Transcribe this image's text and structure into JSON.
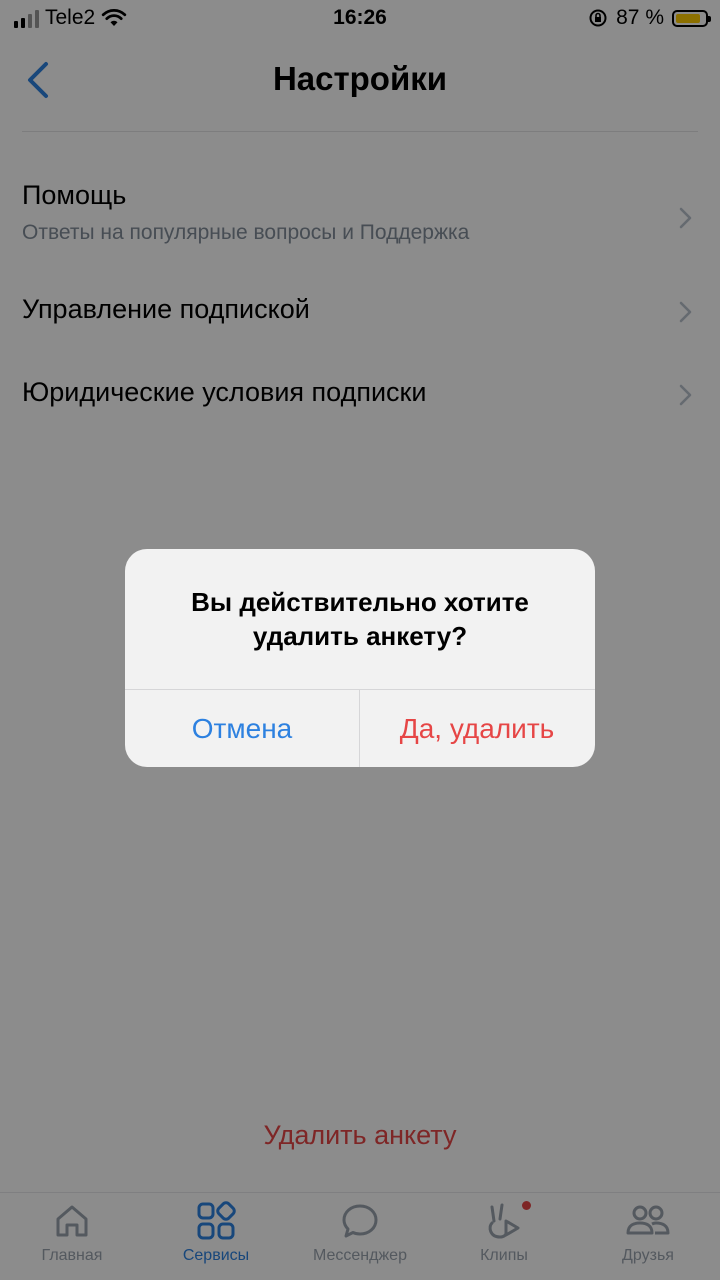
{
  "status_bar": {
    "carrier": "Tele2",
    "time": "16:26",
    "battery_percent": "87 %",
    "battery_level": 0.87
  },
  "header": {
    "title": "Настройки",
    "back_icon": "chevron-left-icon"
  },
  "settings_list": [
    {
      "title": "Помощь",
      "subtitle": "Ответы на популярные вопросы и Поддержка"
    },
    {
      "title": "Управление подпиской"
    },
    {
      "title": "Юридические условия подписки"
    }
  ],
  "delete_link": "Удалить анкету",
  "tab_bar": [
    {
      "label": "Главная",
      "icon": "home-icon",
      "active": false
    },
    {
      "label": "Сервисы",
      "icon": "services-icon",
      "active": true
    },
    {
      "label": "Мессенджер",
      "icon": "chat-icon",
      "active": false
    },
    {
      "label": "Клипы",
      "icon": "clips-icon",
      "active": false,
      "notification_dot": true
    },
    {
      "label": "Друзья",
      "icon": "friends-icon",
      "active": false
    }
  ],
  "dialog": {
    "message": "Вы действительно хотите удалить анкету?",
    "cancel_label": "Отмена",
    "confirm_label": "Да, удалить"
  },
  "colors": {
    "accent": "#2d81e0",
    "destructive": "#e64646",
    "secondary_text": "#818c99"
  }
}
